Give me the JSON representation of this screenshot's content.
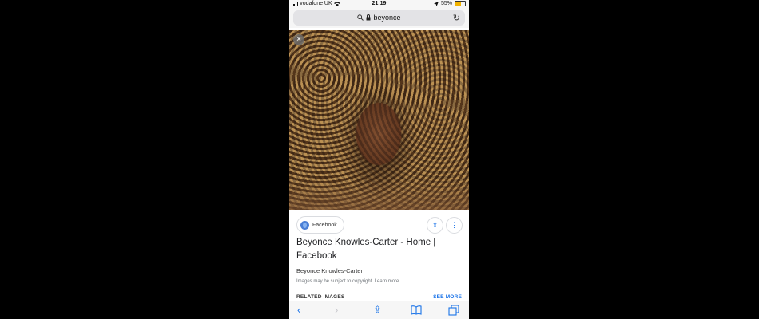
{
  "status": {
    "carrier": "vodafone UK",
    "time": "21:19",
    "battery": "55%"
  },
  "browser": {
    "url_text": "beyonce"
  },
  "result": {
    "source": "Facebook",
    "title": "Beyonce Knowles-Carter - Home | Facebook",
    "subtitle": "Beyonce Knowles-Carter",
    "copyright": "Images may be subject to copyright. Learn more",
    "related_label": "RELATED IMAGES",
    "see_more": "SEE MORE"
  },
  "icons": {
    "close": "×",
    "share": "⇪",
    "more": "⋮",
    "reload": "↻",
    "back": "‹",
    "forward": "›",
    "bookmarks": "📖",
    "tabs": "⧉"
  }
}
